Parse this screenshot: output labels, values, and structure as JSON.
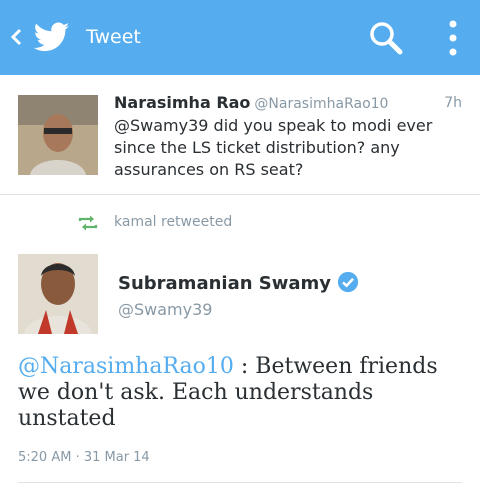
{
  "appbar": {
    "title": "Tweet",
    "icons": {
      "back": "chevron-left-icon",
      "logo": "twitter-bird-icon",
      "search": "search-icon",
      "more": "more-vertical-icon"
    },
    "color": "#55acee"
  },
  "parent_tweet": {
    "name": "Narasimha Rao",
    "handle": "@NarasimhaRao10",
    "time": "7h",
    "text": "@Swamy39 did you speak to modi ever since the LS ticket distribution? any assurances on RS seat?"
  },
  "retweet": {
    "text": "kamal retweeted",
    "icon": "retweet-icon",
    "color": "#5fb36b"
  },
  "main_tweet": {
    "name": "Subramanian Swamy",
    "handle": "@Swamy39",
    "verified_icon": "verified-badge-icon",
    "mention": "@NarasimhaRao10",
    "text": " : Between friends we don't ask. Each understands unstated",
    "timestamp": "5:20 AM · 31 Mar 14",
    "mention_color": "#55acee"
  }
}
